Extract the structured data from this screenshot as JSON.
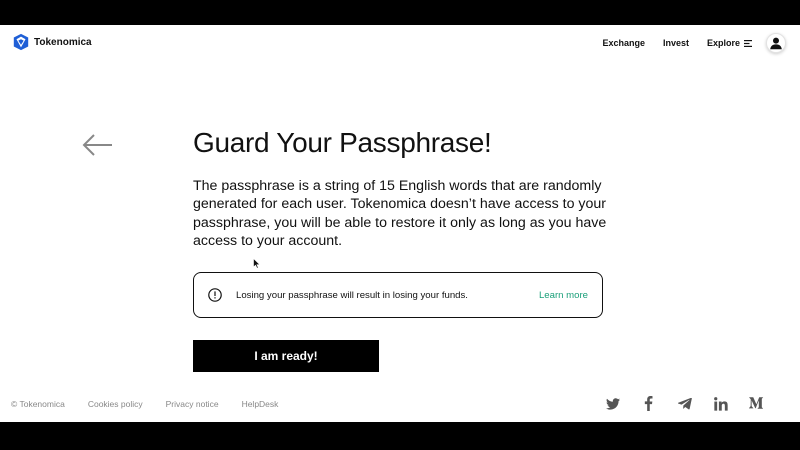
{
  "header": {
    "brand": "Tokenomica",
    "nav": [
      {
        "label": "Exchange"
      },
      {
        "label": "Invest"
      },
      {
        "label": "Explore"
      }
    ]
  },
  "main": {
    "title": "Guard Your Passphrase!",
    "description": "The passphrase is a string of 15 English words that are randomly generated for each user. Tokenomica doesn’t have access to your passphrase, you will be able to restore it only as long as you have access to your account.",
    "notice": {
      "text": "Losing your passphrase will result in losing your funds.",
      "link": "Learn more"
    },
    "cta_label": "I am ready!"
  },
  "footer": {
    "copyright": "© Tokenomica",
    "links": [
      "Cookies policy",
      "Privacy notice",
      "HelpDesk"
    ],
    "socials": [
      "twitter-icon",
      "facebook-icon",
      "telegram-icon",
      "linkedin-icon",
      "medium-icon"
    ]
  },
  "colors": {
    "accent_link": "#1ba07a",
    "button_bg": "#000000",
    "brand_blue": "#1f5fd6"
  }
}
